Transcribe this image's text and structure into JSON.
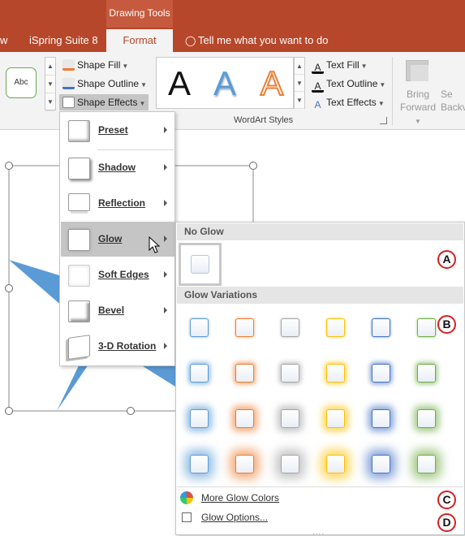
{
  "tabs": {
    "contextual_label": "Drawing Tools",
    "partial_tab": "w",
    "ispring": "iSpring Suite 8",
    "format": "Format",
    "tell_me": "Tell me what you want to do"
  },
  "ribbon": {
    "shape_style_sample": "Abc",
    "shape_fill": "Shape Fill",
    "shape_outline": "Shape Outline",
    "shape_effects": "Shape Effects",
    "wordart_sample": "A",
    "text_fill": "Text Fill",
    "text_outline": "Text Outline",
    "text_effects": "Text Effects",
    "wordart_group_label": "WordArt Styles",
    "bring_forward_line1": "Bring",
    "bring_forward_line2": "Forward",
    "send_backward_line1": "Se",
    "send_backward_line2": "Backv"
  },
  "effects_menu": {
    "items": [
      {
        "label": "Preset"
      },
      {
        "label": "Shadow"
      },
      {
        "label": "Reflection"
      },
      {
        "label": "Glow"
      },
      {
        "label": "Soft Edges"
      },
      {
        "label": "Bevel"
      },
      {
        "label": "3-D Rotation"
      }
    ],
    "hovered": "Glow"
  },
  "glow_gallery": {
    "no_glow_header": "No Glow",
    "variations_header": "Glow Variations",
    "variation_colors": [
      "#5b9bd5",
      "#ed7d31",
      "#a5a5a5",
      "#ffc000",
      "#4472c4",
      "#70ad47"
    ],
    "variation_rows": 4,
    "more_colors": "More Glow Colors",
    "options": "Glow Options...",
    "grip": "....",
    "annotations": [
      "A",
      "B",
      "C",
      "D"
    ]
  },
  "colors": {
    "accent_red": "#b7472a",
    "star_fill": "#5b9bd5",
    "annotation_red": "#d62020"
  }
}
